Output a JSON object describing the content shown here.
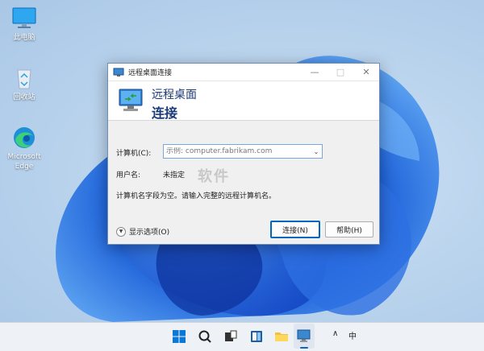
{
  "desktop": {
    "icons": [
      {
        "label": "此电脑"
      },
      {
        "label": "回收站"
      },
      {
        "label": "Microsoft Edge"
      }
    ]
  },
  "dialog": {
    "title": "远程桌面连接",
    "header_line1": "远程桌面",
    "header_line2": "连接",
    "computer_label": "计算机(C):",
    "computer_placeholder": "示例: computer.fabrikam.com",
    "username_label": "用户名:",
    "username_value": "未指定",
    "message": "计算机名字段为空。请输入完整的远程计算机名。",
    "options_label": "显示选项(O)",
    "connect_button": "连接(N)",
    "help_button": "帮助(H)"
  },
  "watermark": "软件",
  "taskbar": {
    "tray_chevron": "∧",
    "ime": "中"
  },
  "colors": {
    "accent": "#0067c0",
    "header_text": "#1b3a78",
    "bloom": "#1a57d6"
  }
}
